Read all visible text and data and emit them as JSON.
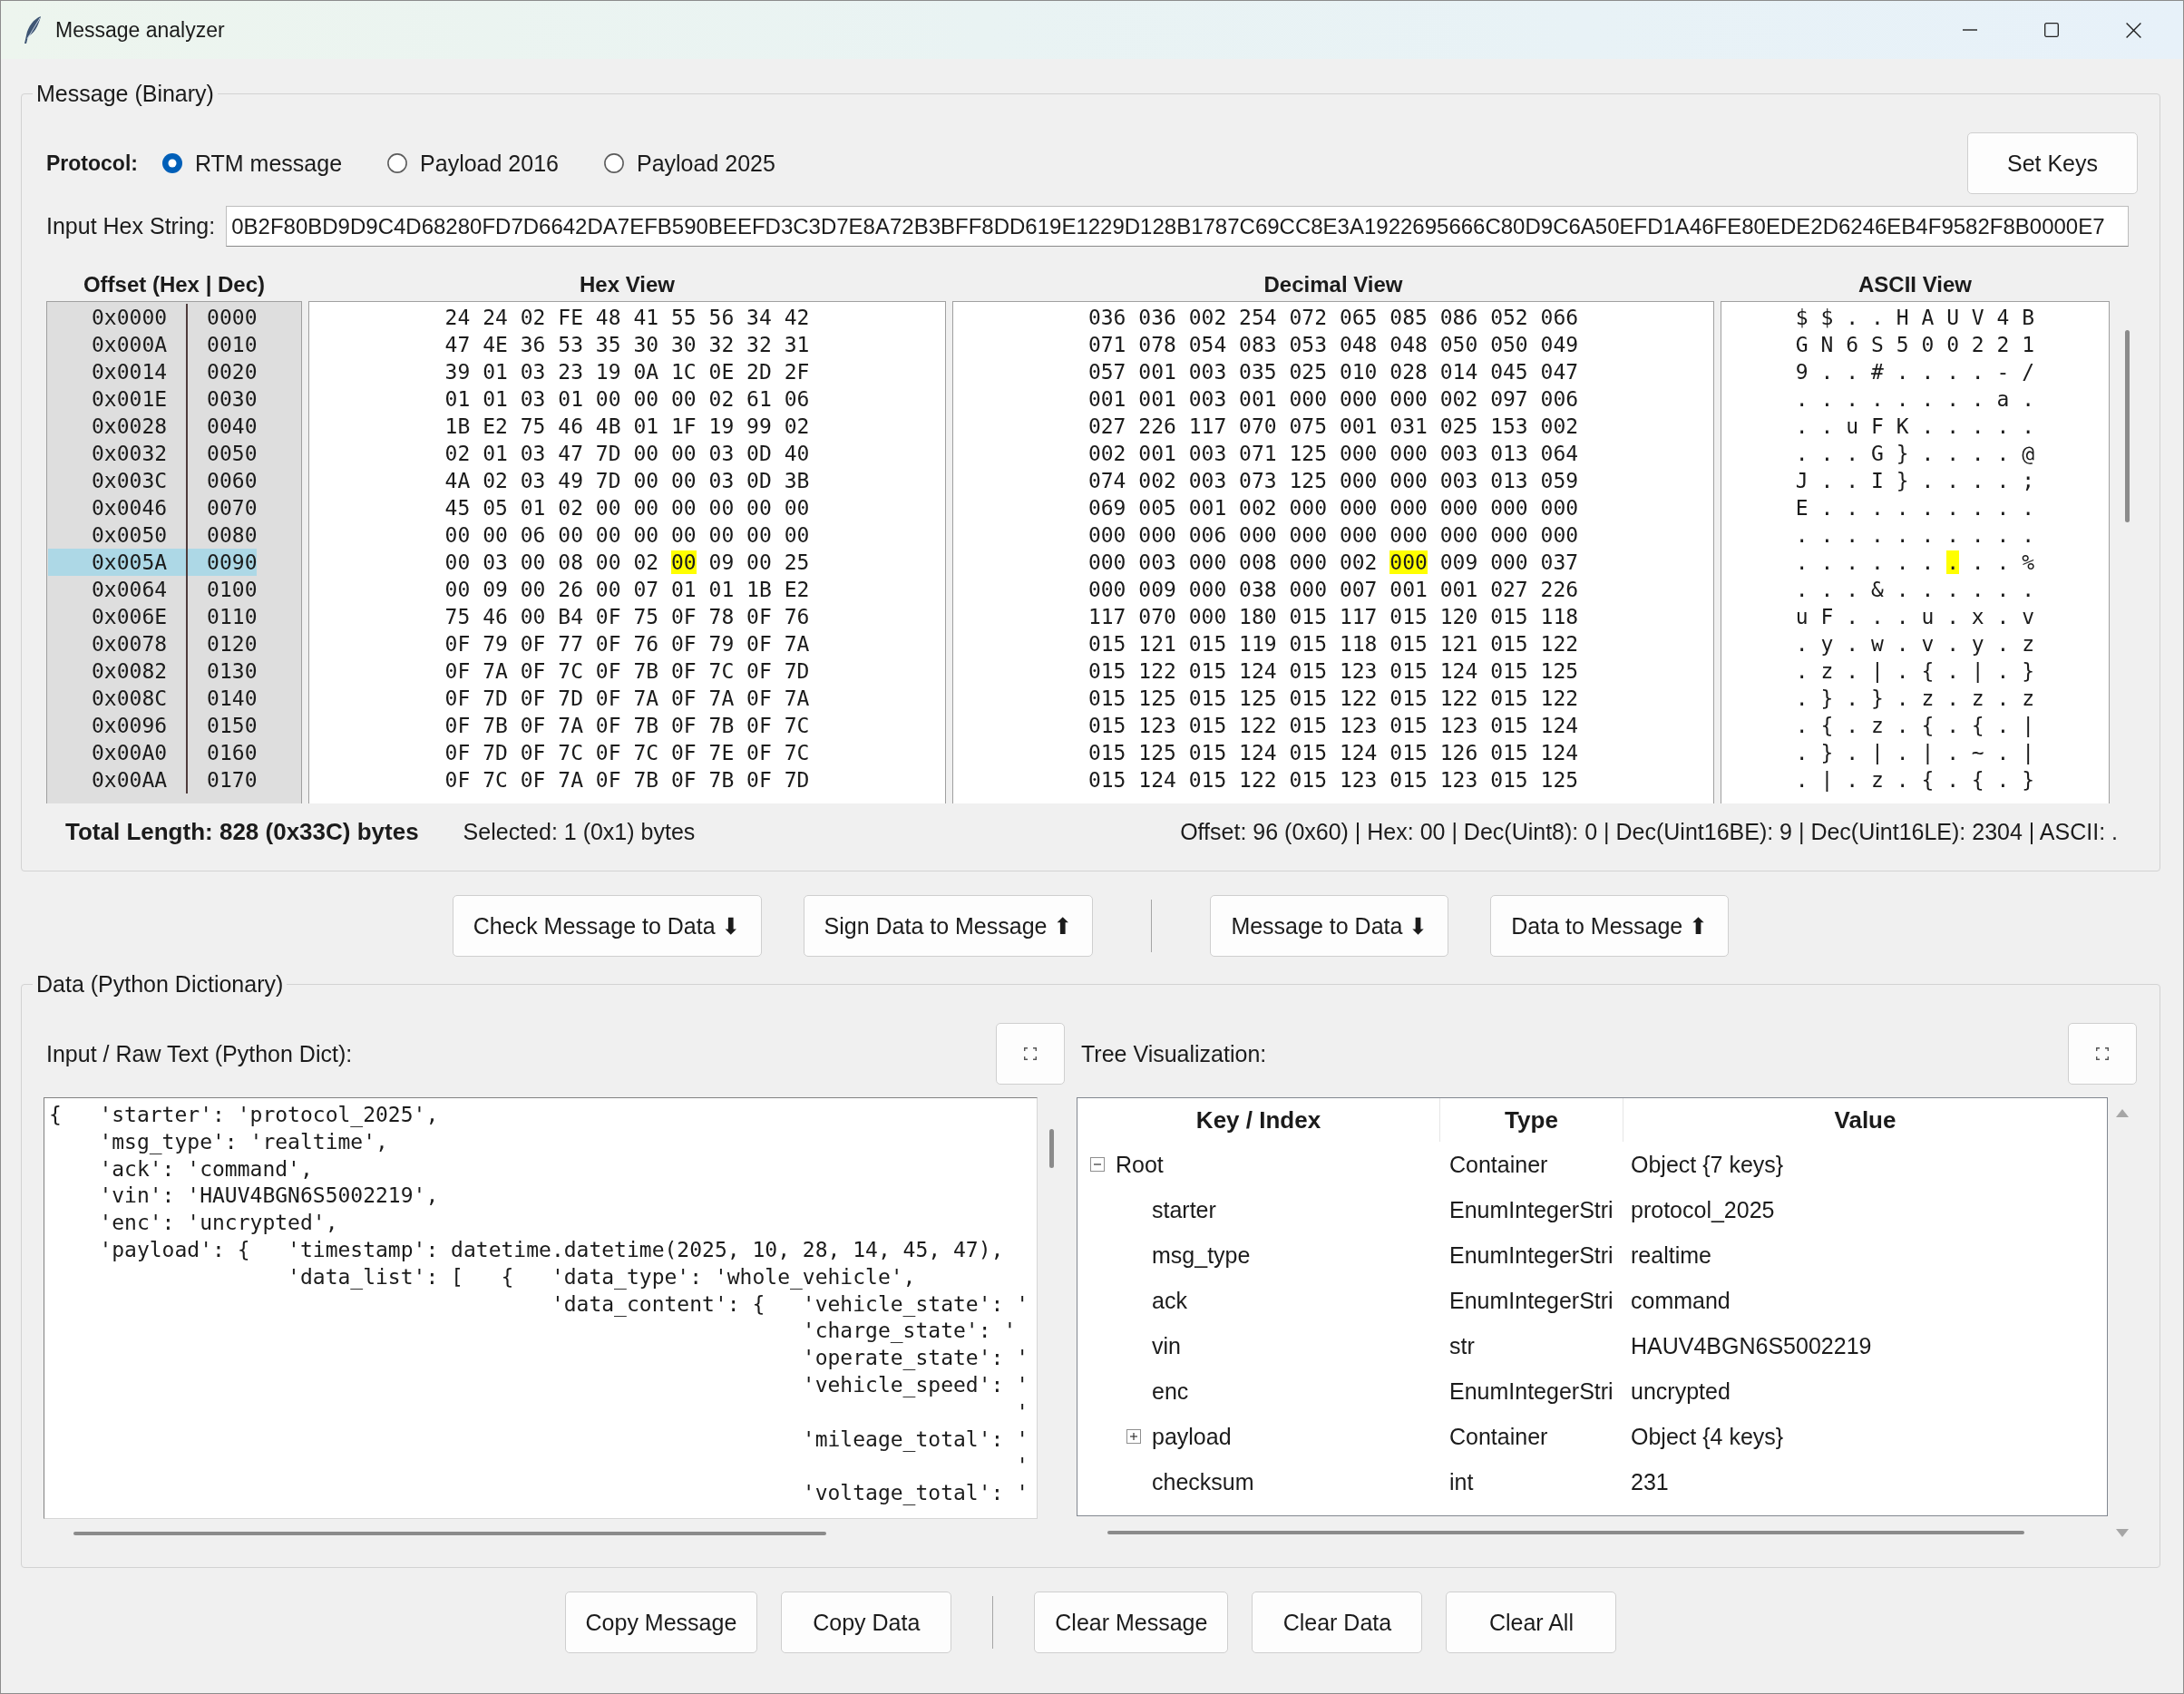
{
  "window": {
    "title": "Message analyzer"
  },
  "message_group": {
    "title": "Message (Binary)",
    "protocol": {
      "label": "Protocol:",
      "options": [
        {
          "label": "RTM message",
          "selected": true
        },
        {
          "label": "Payload 2016",
          "selected": false
        },
        {
          "label": "Payload 2025",
          "selected": false
        }
      ]
    },
    "set_keys_button": "Set Keys",
    "hex_input": {
      "label": "Input Hex String:",
      "value": "0B2F80BD9D9C4D68280FD7D6642DA7EFB590BEEFD3C3D7E8A72B3BFF8DD619E1229D128B1787C69CC8E3A1922695666C80D9C6A50EFD1A46FE80EDE2D6246EB4F9582F8B0000E7"
    },
    "table": {
      "columns": [
        "Offset (Hex | Dec)",
        "Hex View",
        "Decimal View",
        "ASCII View"
      ],
      "rows": [
        {
          "offset_hex": "0x0000",
          "offset_dec": "0000",
          "selected": false,
          "hex": [
            "24",
            "24",
            "02",
            "FE",
            "48",
            "41",
            "55",
            "56",
            "34",
            "42"
          ],
          "dec": [
            "036",
            "036",
            "002",
            "254",
            "072",
            "065",
            "085",
            "086",
            "052",
            "066"
          ],
          "ascii": [
            "$",
            "$",
            ".",
            ".",
            "H",
            "A",
            "U",
            "V",
            "4",
            "B"
          ],
          "byte_selected": [
            false,
            false,
            false,
            false,
            false,
            false,
            false,
            false,
            false,
            false
          ]
        },
        {
          "offset_hex": "0x000A",
          "offset_dec": "0010",
          "selected": false,
          "hex": [
            "47",
            "4E",
            "36",
            "53",
            "35",
            "30",
            "30",
            "32",
            "32",
            "31"
          ],
          "dec": [
            "071",
            "078",
            "054",
            "083",
            "053",
            "048",
            "048",
            "050",
            "050",
            "049"
          ],
          "ascii": [
            "G",
            "N",
            "6",
            "S",
            "5",
            "0",
            "0",
            "2",
            "2",
            "1"
          ],
          "byte_selected": [
            false,
            false,
            false,
            false,
            false,
            false,
            false,
            false,
            false,
            false
          ]
        },
        {
          "offset_hex": "0x0014",
          "offset_dec": "0020",
          "selected": false,
          "hex": [
            "39",
            "01",
            "03",
            "23",
            "19",
            "0A",
            "1C",
            "0E",
            "2D",
            "2F"
          ],
          "dec": [
            "057",
            "001",
            "003",
            "035",
            "025",
            "010",
            "028",
            "014",
            "045",
            "047"
          ],
          "ascii": [
            "9",
            ".",
            ".",
            "#",
            ".",
            ".",
            ".",
            ".",
            "-",
            "/"
          ],
          "byte_selected": [
            false,
            false,
            false,
            false,
            false,
            false,
            false,
            false,
            false,
            false
          ]
        },
        {
          "offset_hex": "0x001E",
          "offset_dec": "0030",
          "selected": false,
          "hex": [
            "01",
            "01",
            "03",
            "01",
            "00",
            "00",
            "00",
            "02",
            "61",
            "06"
          ],
          "dec": [
            "001",
            "001",
            "003",
            "001",
            "000",
            "000",
            "000",
            "002",
            "097",
            "006"
          ],
          "ascii": [
            ".",
            ".",
            ".",
            ".",
            ".",
            ".",
            ".",
            ".",
            "a",
            "."
          ],
          "byte_selected": [
            false,
            false,
            false,
            false,
            false,
            false,
            false,
            false,
            false,
            false
          ]
        },
        {
          "offset_hex": "0x0028",
          "offset_dec": "0040",
          "selected": false,
          "hex": [
            "1B",
            "E2",
            "75",
            "46",
            "4B",
            "01",
            "1F",
            "19",
            "99",
            "02"
          ],
          "dec": [
            "027",
            "226",
            "117",
            "070",
            "075",
            "001",
            "031",
            "025",
            "153",
            "002"
          ],
          "ascii": [
            ".",
            ".",
            "u",
            "F",
            "K",
            ".",
            ".",
            ".",
            ".",
            "."
          ],
          "byte_selected": [
            false,
            false,
            false,
            false,
            false,
            false,
            false,
            false,
            false,
            false
          ]
        },
        {
          "offset_hex": "0x0032",
          "offset_dec": "0050",
          "selected": false,
          "hex": [
            "02",
            "01",
            "03",
            "47",
            "7D",
            "00",
            "00",
            "03",
            "0D",
            "40"
          ],
          "dec": [
            "002",
            "001",
            "003",
            "071",
            "125",
            "000",
            "000",
            "003",
            "013",
            "064"
          ],
          "ascii": [
            ".",
            ".",
            ".",
            "G",
            "}",
            ".",
            ".",
            ".",
            ".",
            "@"
          ],
          "byte_selected": [
            false,
            false,
            false,
            false,
            false,
            false,
            false,
            false,
            false,
            false
          ]
        },
        {
          "offset_hex": "0x003C",
          "offset_dec": "0060",
          "selected": false,
          "hex": [
            "4A",
            "02",
            "03",
            "49",
            "7D",
            "00",
            "00",
            "03",
            "0D",
            "3B"
          ],
          "dec": [
            "074",
            "002",
            "003",
            "073",
            "125",
            "000",
            "000",
            "003",
            "013",
            "059"
          ],
          "ascii": [
            "J",
            ".",
            ".",
            "I",
            "}",
            ".",
            ".",
            ".",
            ".",
            ";"
          ],
          "byte_selected": [
            false,
            false,
            false,
            false,
            false,
            false,
            false,
            false,
            false,
            false
          ]
        },
        {
          "offset_hex": "0x0046",
          "offset_dec": "0070",
          "selected": false,
          "hex": [
            "45",
            "05",
            "01",
            "02",
            "00",
            "00",
            "00",
            "00",
            "00",
            "00"
          ],
          "dec": [
            "069",
            "005",
            "001",
            "002",
            "000",
            "000",
            "000",
            "000",
            "000",
            "000"
          ],
          "ascii": [
            "E",
            ".",
            ".",
            ".",
            ".",
            ".",
            ".",
            ".",
            ".",
            "."
          ],
          "byte_selected": [
            false,
            false,
            false,
            false,
            false,
            false,
            false,
            false,
            false,
            false
          ]
        },
        {
          "offset_hex": "0x0050",
          "offset_dec": "0080",
          "selected": false,
          "hex": [
            "00",
            "00",
            "06",
            "00",
            "00",
            "00",
            "00",
            "00",
            "00",
            "00"
          ],
          "dec": [
            "000",
            "000",
            "006",
            "000",
            "000",
            "000",
            "000",
            "000",
            "000",
            "000"
          ],
          "ascii": [
            ".",
            ".",
            ".",
            ".",
            ".",
            ".",
            ".",
            ".",
            ".",
            "."
          ],
          "byte_selected": [
            false,
            false,
            false,
            false,
            false,
            false,
            false,
            false,
            false,
            false
          ]
        },
        {
          "offset_hex": "0x005A",
          "offset_dec": "0090",
          "selected": true,
          "hex": [
            "00",
            "03",
            "00",
            "08",
            "00",
            "02",
            "00",
            "09",
            "00",
            "25"
          ],
          "dec": [
            "000",
            "003",
            "000",
            "008",
            "000",
            "002",
            "000",
            "009",
            "000",
            "037"
          ],
          "ascii": [
            ".",
            ".",
            ".",
            ".",
            ".",
            ".",
            ".",
            ".",
            ".",
            "%"
          ],
          "byte_selected": [
            false,
            false,
            false,
            false,
            false,
            false,
            true,
            false,
            false,
            false
          ]
        },
        {
          "offset_hex": "0x0064",
          "offset_dec": "0100",
          "selected": false,
          "hex": [
            "00",
            "09",
            "00",
            "26",
            "00",
            "07",
            "01",
            "01",
            "1B",
            "E2"
          ],
          "dec": [
            "000",
            "009",
            "000",
            "038",
            "000",
            "007",
            "001",
            "001",
            "027",
            "226"
          ],
          "ascii": [
            ".",
            ".",
            ".",
            "&",
            ".",
            ".",
            ".",
            ".",
            ".",
            "."
          ],
          "byte_selected": [
            false,
            false,
            false,
            false,
            false,
            false,
            false,
            false,
            false,
            false
          ]
        },
        {
          "offset_hex": "0x006E",
          "offset_dec": "0110",
          "selected": false,
          "hex": [
            "75",
            "46",
            "00",
            "B4",
            "0F",
            "75",
            "0F",
            "78",
            "0F",
            "76"
          ],
          "dec": [
            "117",
            "070",
            "000",
            "180",
            "015",
            "117",
            "015",
            "120",
            "015",
            "118"
          ],
          "ascii": [
            "u",
            "F",
            ".",
            ".",
            ".",
            "u",
            ".",
            "x",
            ".",
            "v"
          ],
          "byte_selected": [
            false,
            false,
            false,
            false,
            false,
            false,
            false,
            false,
            false,
            false
          ]
        },
        {
          "offset_hex": "0x0078",
          "offset_dec": "0120",
          "selected": false,
          "hex": [
            "0F",
            "79",
            "0F",
            "77",
            "0F",
            "76",
            "0F",
            "79",
            "0F",
            "7A"
          ],
          "dec": [
            "015",
            "121",
            "015",
            "119",
            "015",
            "118",
            "015",
            "121",
            "015",
            "122"
          ],
          "ascii": [
            ".",
            "y",
            ".",
            "w",
            ".",
            "v",
            ".",
            "y",
            ".",
            "z"
          ],
          "byte_selected": [
            false,
            false,
            false,
            false,
            false,
            false,
            false,
            false,
            false,
            false
          ]
        },
        {
          "offset_hex": "0x0082",
          "offset_dec": "0130",
          "selected": false,
          "hex": [
            "0F",
            "7A",
            "0F",
            "7C",
            "0F",
            "7B",
            "0F",
            "7C",
            "0F",
            "7D"
          ],
          "dec": [
            "015",
            "122",
            "015",
            "124",
            "015",
            "123",
            "015",
            "124",
            "015",
            "125"
          ],
          "ascii": [
            ".",
            "z",
            ".",
            "|",
            ".",
            "{",
            ".",
            "|",
            ".",
            "}"
          ],
          "byte_selected": [
            false,
            false,
            false,
            false,
            false,
            false,
            false,
            false,
            false,
            false
          ]
        },
        {
          "offset_hex": "0x008C",
          "offset_dec": "0140",
          "selected": false,
          "hex": [
            "0F",
            "7D",
            "0F",
            "7D",
            "0F",
            "7A",
            "0F",
            "7A",
            "0F",
            "7A"
          ],
          "dec": [
            "015",
            "125",
            "015",
            "125",
            "015",
            "122",
            "015",
            "122",
            "015",
            "122"
          ],
          "ascii": [
            ".",
            "}",
            ".",
            "}",
            ".",
            "z",
            ".",
            "z",
            ".",
            "z"
          ],
          "byte_selected": [
            false,
            false,
            false,
            false,
            false,
            false,
            false,
            false,
            false,
            false
          ]
        },
        {
          "offset_hex": "0x0096",
          "offset_dec": "0150",
          "selected": false,
          "hex": [
            "0F",
            "7B",
            "0F",
            "7A",
            "0F",
            "7B",
            "0F",
            "7B",
            "0F",
            "7C"
          ],
          "dec": [
            "015",
            "123",
            "015",
            "122",
            "015",
            "123",
            "015",
            "123",
            "015",
            "124"
          ],
          "ascii": [
            ".",
            "{",
            ".",
            "z",
            ".",
            "{",
            ".",
            "{",
            ".",
            "|"
          ],
          "byte_selected": [
            false,
            false,
            false,
            false,
            false,
            false,
            false,
            false,
            false,
            false
          ]
        },
        {
          "offset_hex": "0x00A0",
          "offset_dec": "0160",
          "selected": false,
          "hex": [
            "0F",
            "7D",
            "0F",
            "7C",
            "0F",
            "7C",
            "0F",
            "7E",
            "0F",
            "7C"
          ],
          "dec": [
            "015",
            "125",
            "015",
            "124",
            "015",
            "124",
            "015",
            "126",
            "015",
            "124"
          ],
          "ascii": [
            ".",
            "}",
            ".",
            "|",
            ".",
            "|",
            ".",
            "~",
            ".",
            "|"
          ],
          "byte_selected": [
            false,
            false,
            false,
            false,
            false,
            false,
            false,
            false,
            false,
            false
          ]
        },
        {
          "offset_hex": "0x00AA",
          "offset_dec": "0170",
          "selected": false,
          "hex": [
            "0F",
            "7C",
            "0F",
            "7A",
            "0F",
            "7B",
            "0F",
            "7B",
            "0F",
            "7D"
          ],
          "dec": [
            "015",
            "124",
            "015",
            "122",
            "015",
            "123",
            "015",
            "123",
            "015",
            "125"
          ],
          "ascii": [
            ".",
            "|",
            ".",
            "z",
            ".",
            "{",
            ".",
            "{",
            ".",
            "}"
          ],
          "byte_selected": [
            false,
            false,
            false,
            false,
            false,
            false,
            false,
            false,
            false,
            false
          ]
        }
      ]
    },
    "status": {
      "total_length": "Total Length: 828 (0x33C) bytes",
      "selection": "Selected: 1 (0x1) bytes",
      "details": "Offset: 96 (0x60) | Hex: 00 | Dec(Uint8): 0 | Dec(Uint16BE): 9 | Dec(Uint16LE): 2304 | ASCII: ."
    }
  },
  "convert_buttons": [
    [
      "Check Message to Data ⬇",
      "Sign Data to Message ⬆"
    ],
    [
      "Message to Data ⬇",
      "Data to Message ⬆"
    ]
  ],
  "data_group": {
    "title": "Data (Python Dictionary)",
    "raw_text": {
      "label": "Input / Raw Text (Python Dict):",
      "text": "{   'starter': 'protocol_2025',\n    'msg_type': 'realtime',\n    'ack': 'command',\n    'vin': 'HAUV4BGN6S5002219',\n    'enc': 'uncrypted',\n    'payload': {   'timestamp': datetime.datetime(2025, 10, 28, 14, 45, 47),\n                   'data_list': [   {   'data_type': 'whole_vehicle',\n                                        'data_content': {   'vehicle_state': '\n                                                            'charge_state': '\n                                                            'operate_state': '\n                                                            'vehicle_speed': '\n                                                                             '\n                                                            'mileage_total': '\n                                                                             '\n                                                            'voltage_total': '"
    },
    "tree": {
      "label": "Tree Visualization:",
      "columns": [
        "Key / Index",
        "Type",
        "Value"
      ],
      "items": [
        {
          "key": "Root",
          "type": "Container",
          "value": "Object {7 keys}",
          "expanded": true,
          "children": [
            {
              "key": "starter",
              "type": "EnumIntegerStri",
              "value": "protocol_2025"
            },
            {
              "key": "msg_type",
              "type": "EnumIntegerStri",
              "value": "realtime"
            },
            {
              "key": "ack",
              "type": "EnumIntegerStri",
              "value": "command"
            },
            {
              "key": "vin",
              "type": "str",
              "value": "HAUV4BGN6S5002219"
            },
            {
              "key": "enc",
              "type": "EnumIntegerStri",
              "value": "uncrypted"
            },
            {
              "key": "payload",
              "type": "Container",
              "value": "Object {4 keys}",
              "expanded": false
            },
            {
              "key": "checksum",
              "type": "int",
              "value": "231"
            }
          ]
        }
      ]
    }
  },
  "action_buttons": [
    [
      "Copy Message",
      "Copy Data"
    ],
    [
      "Clear Message",
      "Clear Data",
      "Clear All"
    ]
  ]
}
